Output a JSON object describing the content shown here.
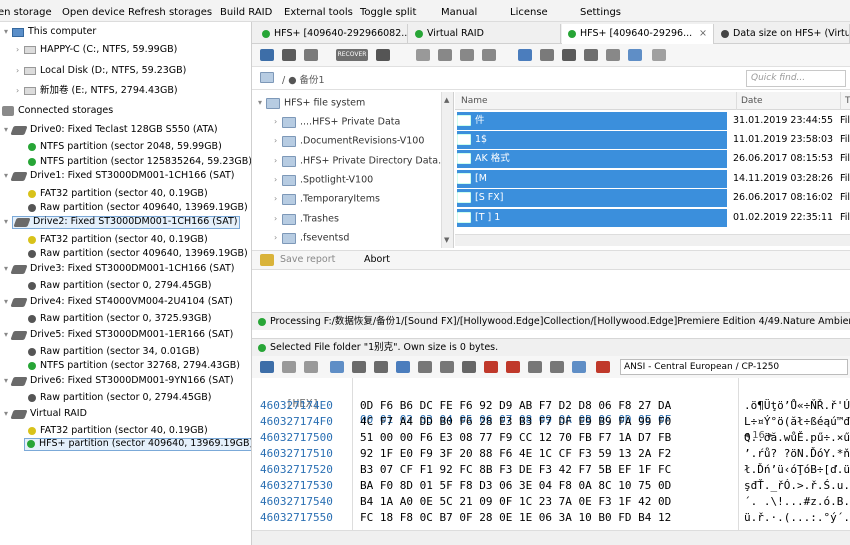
{
  "menu": {
    "items": [
      "en storage",
      "Open device",
      "Refresh storages",
      "Build RAID",
      "External tools",
      "Toggle split",
      "Manual",
      "License",
      "Settings"
    ]
  },
  "left": {
    "this_computer": "This computer",
    "volumes": [
      "HAPPY-C (C:, NTFS, 59.99GB)",
      "Local Disk (D:, NTFS, 59.23GB)",
      "新加卷 (E:, NTFS, 2794.43GB)"
    ],
    "connected": "Connected storages",
    "drives": [
      {
        "label": "Drive0: Fixed Teclast 128GB S550 (ATA)",
        "parts": [
          {
            "label": "NTFS partition (sector 2048, 59.99GB)",
            "color": "#27a536"
          },
          {
            "label": "NTFS partition (sector 125835264, 59.23GB)",
            "color": "#27a536"
          }
        ]
      },
      {
        "label": "Drive1: Fixed ST3000DM001-1CH166 (SAT)",
        "parts": [
          {
            "label": "FAT32 partition (sector 40, 0.19GB)",
            "color": "#d8c21a"
          },
          {
            "label": "Raw partition (sector 409640, 13969.19GB)",
            "color": "#555555"
          }
        ]
      },
      {
        "label": "Drive2: Fixed ST3000DM001-1CH166 (SAT)",
        "parts": [
          {
            "label": "FAT32 partition (sector 40, 0.19GB)",
            "color": "#d8c21a"
          },
          {
            "label": "Raw partition (sector 409640, 13969.19GB)",
            "color": "#555555"
          }
        ]
      },
      {
        "label": "Drive3: Fixed ST3000DM001-1CH166 (SAT)",
        "parts": [
          {
            "label": "Raw partition (sector 0, 2794.45GB)",
            "color": "#555555"
          }
        ]
      },
      {
        "label": "Drive4: Fixed ST4000VM004-2U4104 (SAT)",
        "parts": [
          {
            "label": "Raw partition (sector 0, 3725.93GB)",
            "color": "#555555"
          }
        ]
      },
      {
        "label": "Drive5: Fixed ST3000DM001-1ER166 (SAT)",
        "parts": [
          {
            "label": "Raw partition (sector 34, 0.01GB)",
            "color": "#555555"
          },
          {
            "label": "NTFS partition (sector 32768, 2794.43GB)",
            "color": "#27a536"
          }
        ]
      },
      {
        "label": "Drive6: Fixed ST3000DM001-9YN166 (SAT)",
        "parts": [
          {
            "label": "Raw partition (sector 0, 2794.45GB)",
            "color": "#555555"
          }
        ]
      }
    ],
    "raid": {
      "label": "Virtual RAID",
      "parts": [
        {
          "label": "FAT32 partition (sector 40, 0.19GB)",
          "color": "#d8c21a"
        },
        {
          "label": "HFS+ partition (sector 409640, 13969.19GB)",
          "color": "#27a536"
        }
      ]
    }
  },
  "tabs": [
    {
      "label": "HFS+ [409640-292966082...",
      "close": ""
    },
    {
      "label": "Virtual RAID",
      "close": ""
    },
    {
      "label": "HFS+ [409640-29296...",
      "close": "×"
    },
    {
      "label": "Data size on HFS+ (Virtual",
      "close": ""
    }
  ],
  "toolbar": {
    "recover_label": "RECOVER"
  },
  "address": {
    "path": "/ ● 备份1",
    "quick_find": "Quick find..."
  },
  "tree": {
    "root": "HFS+ file system",
    "items": [
      "....HFS+ Private Data",
      ".DocumentRevisions-V100",
      ".HFS+ Private Directory Data.",
      ".Spotlight-V100",
      ".TemporaryItems",
      ".Trashes",
      ".fseventsd"
    ]
  },
  "list": {
    "headers": {
      "name": "Name",
      "date": "Date",
      "fi": "T"
    },
    "rows": [
      {
        "name": "件",
        "date": "31.01.2019 23:44:55",
        "fi": "Fil"
      },
      {
        "name": "1$",
        "date": "11.01.2019 23:58:03",
        "fi": "Fil"
      },
      {
        "name": "AK 格式",
        "date": "26.06.2017 08:15:53",
        "fi": "Fil"
      },
      {
        "name": "[M",
        "date": "14.11.2019 03:28:26",
        "fi": "Fil"
      },
      {
        "name": "[S FX]",
        "date": "26.06.2017 08:16:02",
        "fi": "Fil"
      },
      {
        "name": "[T ] 1",
        "date": "01.02.2019 22:35:11",
        "fi": "Fil"
      }
    ]
  },
  "report": {
    "save": "Save report",
    "abort": "Abort"
  },
  "status": {
    "processing": "Processing F:/数据恢复/备份1/[Sound FX]/[Hollywood.Edge]Collection/[Hollywood.Edge]Premiere Edition 4/49.Nature Ambiences/31 F",
    "selected": "Selected File folder \"1别克\". Own size is 0 bytes."
  },
  "hex": {
    "encoding": "ANSI - Central European / CP-1250",
    "label": "[HEX]",
    "columns": "00 01 02 03 04 05 06 07 08 09 0A 0B 0C 0D 0E 0F",
    "width_ctrl": "◂ 16 ▸",
    "rows": [
      {
        "off": "460327174E0",
        "hex": "0D F6 B6 DC FE F6 92 D9 AB F7 D2 D8 06 F8 27 DA",
        "asc": ".ö¶Üţö’Ů«÷ŇŘ.ř'Ú"
      },
      {
        "off": "460327174F0",
        "hex": "4C F7 A4 DD B0 F6 28 E3 B3 F7 DF E9 B9 FA 99 F0",
        "asc": "L÷¤Ý°ö(ăł÷ßéąú™đ"
      },
      {
        "off": "46032717500",
        "hex": "51 00 00 F6 E3 08 77 F9 CC 12 70 FB F7 1A D7 FB",
        "asc": "Q..öă.wůĚ.pű÷.×ű"
      },
      {
        "off": "46032717510",
        "hex": "92 1F E0 F9 3F 20 88 F6 4E 1C CF F3 59 13 2A F2",
        "asc": "’.ŕů? ?öN.ĎóY.*ň"
      },
      {
        "off": "46032717520",
        "hex": "B3 07 CF F1 92 FC 8B F3 DE F3 42 F7 5B EF 1F FC",
        "asc": "ł.Ďń’ü‹óŢóB÷[ď.ü"
      },
      {
        "off": "46032717530",
        "hex": "BA F0 8D 01 5F F8 D3 06 3E 04 F8 0A 8C 10 75 0D",
        "asc": "şđŤ._řÓ.>.ř.Ś.u."
      },
      {
        "off": "46032717540",
        "hex": "B4 1A A0 0E 5C 21 09 0F 1C 23 7A 0E F3 1F 42 0D",
        "asc": "´. .\\!...#z.ó.B."
      },
      {
        "off": "46032717550",
        "hex": "FC 18 F8 0C B7 0F 28 0E 1E 06 3A 10 B0 FD B4 12",
        "asc": "ü.ř.·.(...:.°ý´."
      }
    ]
  }
}
